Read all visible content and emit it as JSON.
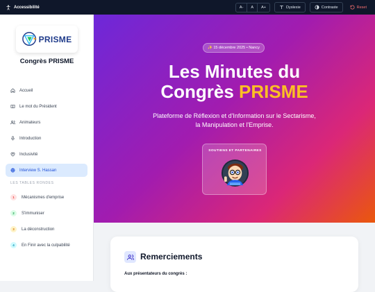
{
  "topbar": {
    "accessibility_label": "Accessibilité",
    "font_decrease": "A-",
    "font_normal": "A",
    "font_increase": "A+",
    "dyslexia_label": "Dyslexie",
    "contrast_label": "Contraste",
    "reset_label": "Reset"
  },
  "sidebar": {
    "logo_text": "PRISME",
    "conference_title": "Congrès PRISME",
    "nav": [
      {
        "label": "Accueil",
        "icon": "home-icon"
      },
      {
        "label": "Le mot du Président",
        "icon": "book-icon"
      },
      {
        "label": "Animateurs",
        "icon": "users-icon"
      },
      {
        "label": "Introduction",
        "icon": "mic-icon"
      },
      {
        "label": "Inclusivité",
        "icon": "heart-handshake-icon"
      },
      {
        "label": "Interview S. Hassan",
        "icon": "globe-icon",
        "active": true
      }
    ],
    "section_title": "LES TABLES RONDES",
    "round_tables": [
      {
        "num": "1",
        "label": "Mécanismes d'emprise",
        "color": "#ef4444",
        "bg": "#fee2e2"
      },
      {
        "num": "2",
        "label": "S'immuniser",
        "color": "#16a34a",
        "bg": "#dcfce7"
      },
      {
        "num": "3",
        "label": "La déconstruction",
        "color": "#d97706",
        "bg": "#fef3c7"
      },
      {
        "num": "4",
        "label": "En Finir avec la culpabilité",
        "color": "#0891b2",
        "bg": "#cffafe"
      }
    ]
  },
  "hero": {
    "date_badge": "✨ 15 décembre 2025 • Nancy",
    "title_line1": "Les Minutes du",
    "title_line2_prefix": "Congrès ",
    "title_line2_accent": "PRISME",
    "subtitle_line1": "Plateforme de Réflexion et d'Information sur le Sectarisme,",
    "subtitle_line2": "la Manipulation et l'Emprise.",
    "sponsors_label": "SOUTIENS ET PARTENAIRES"
  },
  "card": {
    "title": "Remerciements",
    "text": "Aux présentateurs du congrès :"
  },
  "colors": {
    "accent": "#fbbf24",
    "active_nav_bg": "#dbeafe",
    "active_nav_text": "#1d4ed8",
    "topbar_bg": "#0f172a"
  }
}
